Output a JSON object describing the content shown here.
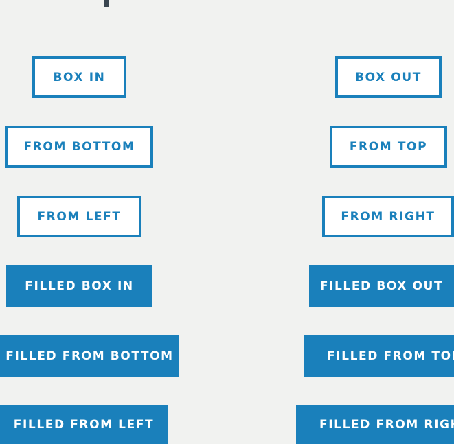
{
  "buttons": {
    "box_in": "BOX IN",
    "box_out": "BOX OUT",
    "from_bottom": "FROM BOTTOM",
    "from_top": "FROM TOP",
    "from_left": "FROM LEFT",
    "from_right": "FROM RIGHT",
    "filled_box_in": "FILLED BOX IN",
    "filled_box_out": "FILLED BOX OUT",
    "filled_from_bottom": "FILLED FROM BOTTOM",
    "filled_from_top": "FILLED FROM TOP",
    "filled_from_left": "FILLED FROM LEFT",
    "filled_from_right": "FILLED FROM RIGHT"
  },
  "colors": {
    "accent": "#1a80bb",
    "background": "#f1f2f0",
    "outline_fill": "#ffffff",
    "filled_text": "#ffffff"
  }
}
